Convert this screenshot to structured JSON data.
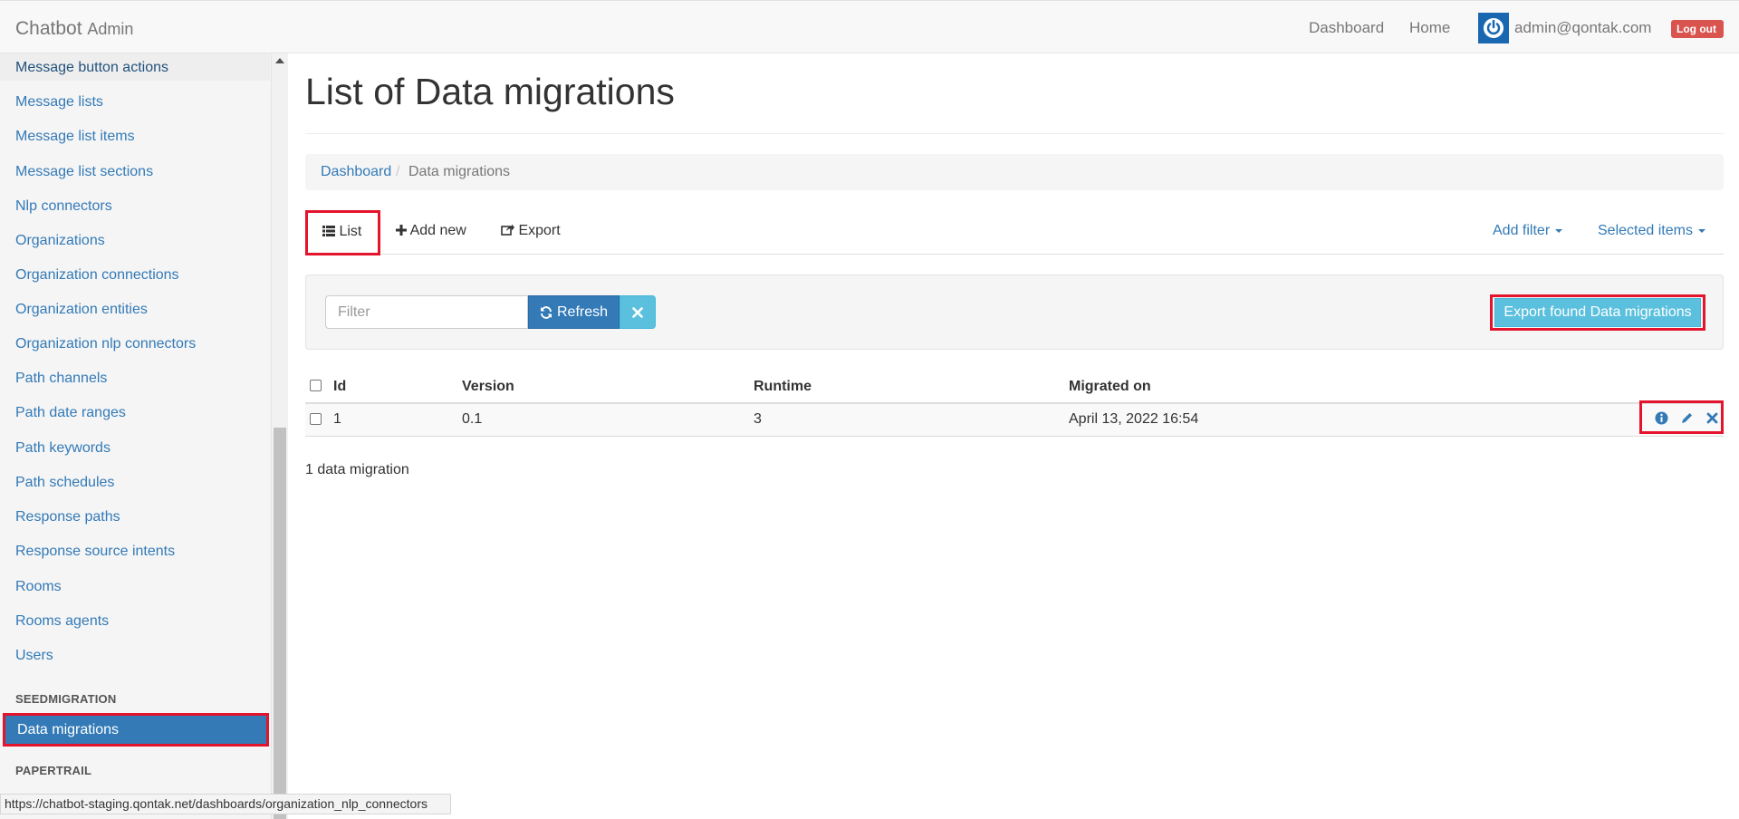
{
  "navbar": {
    "brand": "Chatbot",
    "brand_sub": "Admin",
    "links": [
      "Dashboard",
      "Home"
    ],
    "user_email": "admin@qontak.com",
    "logout_label": "Log out"
  },
  "sidebar": {
    "items": [
      "Message button actions",
      "Message lists",
      "Message list items",
      "Message list sections",
      "Nlp connectors",
      "Organizations",
      "Organization connections",
      "Organization entities",
      "Organization nlp connectors",
      "Path channels",
      "Path date ranges",
      "Path keywords",
      "Path schedules",
      "Response paths",
      "Response source intents",
      "Rooms",
      "Rooms agents",
      "Users"
    ],
    "section_seed": "SEEDMIGRATION",
    "active_item": "Data migrations",
    "section_paper": "PAPERTRAIL"
  },
  "status_url": "https://chatbot-staging.qontak.net/dashboards/organization_nlp_connectors",
  "page": {
    "title": "List of Data migrations",
    "breadcrumb": {
      "link": "Dashboard",
      "separator": "/",
      "current": "Data migrations"
    },
    "tabs": {
      "list": "List",
      "add_new": "Add new",
      "export": "Export"
    },
    "dropdowns": {
      "add_filter": "Add filter",
      "selected_items": "Selected items"
    }
  },
  "filter": {
    "placeholder": "Filter",
    "refresh_label": "Refresh",
    "export_label": "Export found Data migrations"
  },
  "table": {
    "headers": {
      "id": "Id",
      "version": "Version",
      "runtime": "Runtime",
      "migrated_on": "Migrated on"
    },
    "rows": [
      {
        "id": "1",
        "version": "0.1",
        "runtime": "3",
        "migrated_on": "April 13, 2022 16:54"
      }
    ]
  },
  "count_label": "1 data migration",
  "colors": {
    "link": "#337ab7",
    "primary": "#337ab7",
    "info": "#5bc0de",
    "danger": "#d9534f",
    "highlight": "#e3142b"
  },
  "icons": [
    "power-icon",
    "list-icon",
    "plus-icon",
    "share-icon",
    "refresh-icon",
    "remove-icon",
    "info-icon",
    "pencil-icon",
    "close-icon"
  ]
}
